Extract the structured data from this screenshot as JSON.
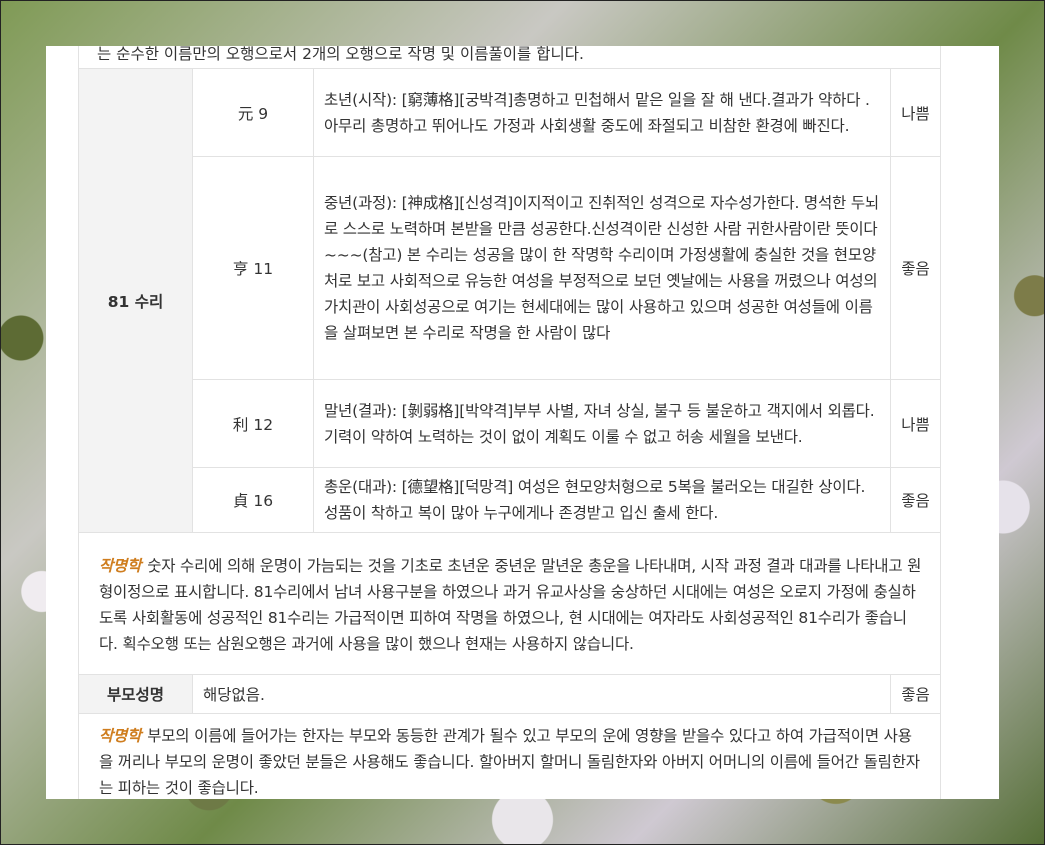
{
  "top_note": "는 순수한 이름만의 오행으로서 2개의 오행으로 작명 및 이름풀이를 합니다.",
  "section_label": "81 수리",
  "rows": [
    {
      "sub": "元 9",
      "desc": "초년(시작): [窮薄格][궁박격]총명하고 민첩해서 맡은 일을 잘 해 낸다.결과가 약하다 . 아무리 총명하고 뛰어나도 가정과 사회생활 중도에 좌절되고 비참한 환경에 빠진다.",
      "rating": "나쁨",
      "rating_color": "#dd2222"
    },
    {
      "sub": "亨 11",
      "desc": "중년(과정): [神成格][신성격]이지적이고 진취적인 성격으로 자수성가한다. 명석한 두뇌로 스스로 노력하며 본받을 만큼 성공한다.신성격이란 신성한 사람 귀한사람이란 뜻이다\n~~~(참고) 본 수리는 성공을 많이 한 작명학 수리이며 가정생활에 충실한 것을 현모양처로 보고 사회적으로 유능한 여성을 부정적으로 보던 옛날에는 사용을 꺼렸으나 여성의 가치관이 사회성공으로 여기는 현세대에는 많이 사용하고 있으며 성공한 여성들에 이름을 살펴보면 본 수리로 작명을 한 사람이 많다",
      "rating": "좋음",
      "rating_color": "#1a1aa8"
    },
    {
      "sub": "利 12",
      "desc": "말년(결과): [剝弱格][박약격]부부 사별, 자녀 상실, 불구 등 불운하고 객지에서 외롭다. 기력이 약하여 노력하는 것이 없이 계획도 이룰 수 없고 허송 세월을 보낸다.",
      "rating": "나쁨",
      "rating_color": "#dd2222"
    },
    {
      "sub": "貞 16",
      "desc": "총운(대과): [德望格][덕망격] 여성은 현모양처형으로 5복을 불러오는 대길한 상이다. 성품이 착하고 복이 많아 누구에게나 존경받고 입신 출세 한다.",
      "rating": "좋음",
      "rating_color": "#1a1aa8"
    }
  ],
  "note1": {
    "title": "작명학",
    "text": "숫자 수리에 의해 운명이 가늠되는 것을 기초로 초년운 중년운 말년운 총운을 나타내며, 시작 과정 결과 대과를 나타내고 원형이정으로 표시합니다. 81수리에서 남녀 사용구분을 하였으나 과거 유교사상을 숭상하던 시대에는 여성은 오로지 가정에 충실하도록 사회활동에 성공적인 81수리는 가급적이면 피하여 작명을 하였으나, 현 시대에는 여자라도 사회성공적인 81수리가 좋습니다. 획수오행 또는 삼원오행은 과거에 사용을 많이 했으나 현재는 사용하지 않습니다."
  },
  "parent": {
    "label": "부모성명",
    "value": "해당없음.",
    "rating": "좋음"
  },
  "note2": {
    "title": "작명학",
    "text": "부모의 이름에 들어가는 한자는 부모와 동등한 관계가 될수 있고 부모의 운에 영향을 받을수 있다고 하여 가급적이면 사용을 꺼리나 부모의 운명이 좋았던 분들은 사용해도 좋습니다. 할아버지 할머니 돌림한자와 아버지 어머니의 이름에 들어간 돌림한자는 피하는 것이 좋습니다."
  }
}
